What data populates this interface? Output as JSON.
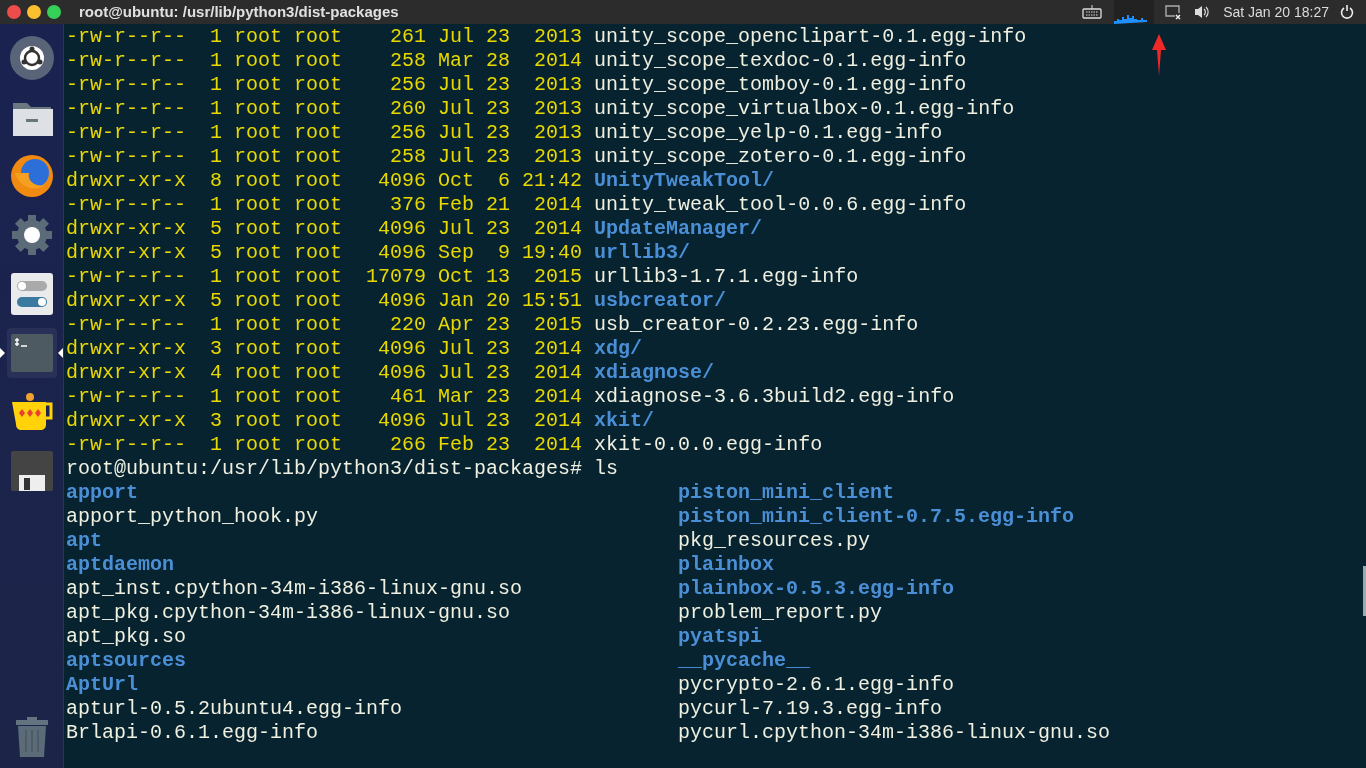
{
  "window": {
    "title": "root@ubuntu: /usr/lib/python3/dist-packages"
  },
  "panel": {
    "clock": "Sat Jan 20 18:27"
  },
  "launcher": [
    {
      "kind": "dash",
      "active": false
    },
    {
      "kind": "files",
      "active": false
    },
    {
      "kind": "browser",
      "active": false
    },
    {
      "kind": "settings",
      "active": false
    },
    {
      "kind": "tweak",
      "active": false
    },
    {
      "kind": "terminal",
      "active": true
    },
    {
      "kind": "teapot",
      "active": false
    },
    {
      "kind": "disk",
      "active": false
    },
    {
      "kind": "trash",
      "active": false
    }
  ],
  "listing": [
    {
      "info": "-rw-r--r--  1 root root    261 Jul 23  2013",
      "name": "unity_scope_openclipart-0.1.egg-info",
      "kind": "file"
    },
    {
      "info": "-rw-r--r--  1 root root    258 Mar 28  2014",
      "name": "unity_scope_texdoc-0.1.egg-info",
      "kind": "file"
    },
    {
      "info": "-rw-r--r--  1 root root    256 Jul 23  2013",
      "name": "unity_scope_tomboy-0.1.egg-info",
      "kind": "file"
    },
    {
      "info": "-rw-r--r--  1 root root    260 Jul 23  2013",
      "name": "unity_scope_virtualbox-0.1.egg-info",
      "kind": "file"
    },
    {
      "info": "-rw-r--r--  1 root root    256 Jul 23  2013",
      "name": "unity_scope_yelp-0.1.egg-info",
      "kind": "file"
    },
    {
      "info": "-rw-r--r--  1 root root    258 Jul 23  2013",
      "name": "unity_scope_zotero-0.1.egg-info",
      "kind": "file"
    },
    {
      "info": "drwxr-xr-x  8 root root   4096 Oct  6 21:42",
      "name": "UnityTweakTool/",
      "kind": "dir"
    },
    {
      "info": "-rw-r--r--  1 root root    376 Feb 21  2014",
      "name": "unity_tweak_tool-0.0.6.egg-info",
      "kind": "file"
    },
    {
      "info": "drwxr-xr-x  5 root root   4096 Jul 23  2014",
      "name": "UpdateManager/",
      "kind": "dir"
    },
    {
      "info": "drwxr-xr-x  5 root root   4096 Sep  9 19:40",
      "name": "urllib3/",
      "kind": "dir"
    },
    {
      "info": "-rw-r--r--  1 root root  17079 Oct 13  2015",
      "name": "urllib3-1.7.1.egg-info",
      "kind": "file"
    },
    {
      "info": "drwxr-xr-x  5 root root   4096 Jan 20 15:51",
      "name": "usbcreator/",
      "kind": "dir"
    },
    {
      "info": "-rw-r--r--  1 root root    220 Apr 23  2015",
      "name": "usb_creator-0.2.23.egg-info",
      "kind": "file"
    },
    {
      "info": "drwxr-xr-x  3 root root   4096 Jul 23  2014",
      "name": "xdg/",
      "kind": "dir"
    },
    {
      "info": "drwxr-xr-x  4 root root   4096 Jul 23  2014",
      "name": "xdiagnose/",
      "kind": "dir"
    },
    {
      "info": "-rw-r--r--  1 root root    461 Mar 23  2014",
      "name": "xdiagnose-3.6.3build2.egg-info",
      "kind": "file"
    },
    {
      "info": "drwxr-xr-x  3 root root   4096 Jul 23  2014",
      "name": "xkit/",
      "kind": "dir"
    },
    {
      "info": "-rw-r--r--  1 root root    266 Feb 23  2014",
      "name": "xkit-0.0.0.egg-info",
      "kind": "file"
    }
  ],
  "prompt": "root@ubuntu:/usr/lib/python3/dist-packages# ls",
  "ls_rows": [
    {
      "left": {
        "name": "apport",
        "kind": "dir"
      },
      "right": {
        "name": "piston_mini_client",
        "kind": "dir"
      }
    },
    {
      "left": {
        "name": "apport_python_hook.py",
        "kind": "file"
      },
      "right": {
        "name": "piston_mini_client-0.7.5.egg-info",
        "kind": "dir"
      }
    },
    {
      "left": {
        "name": "apt",
        "kind": "dir"
      },
      "right": {
        "name": "pkg_resources.py",
        "kind": "file"
      }
    },
    {
      "left": {
        "name": "aptdaemon",
        "kind": "dir"
      },
      "right": {
        "name": "plainbox",
        "kind": "dir"
      }
    },
    {
      "left": {
        "name": "apt_inst.cpython-34m-i386-linux-gnu.so",
        "kind": "file"
      },
      "right": {
        "name": "plainbox-0.5.3.egg-info",
        "kind": "dir"
      }
    },
    {
      "left": {
        "name": "apt_pkg.cpython-34m-i386-linux-gnu.so",
        "kind": "file"
      },
      "right": {
        "name": "problem_report.py",
        "kind": "file"
      }
    },
    {
      "left": {
        "name": "apt_pkg.so",
        "kind": "file"
      },
      "right": {
        "name": "pyatspi",
        "kind": "dir"
      }
    },
    {
      "left": {
        "name": "aptsources",
        "kind": "dir"
      },
      "right": {
        "name": "__pycache__",
        "kind": "dir"
      }
    },
    {
      "left": {
        "name": "AptUrl",
        "kind": "dir"
      },
      "right": {
        "name": "pycrypto-2.6.1.egg-info",
        "kind": "file"
      }
    },
    {
      "left": {
        "name": "apturl-0.5.2ubuntu4.egg-info",
        "kind": "file"
      },
      "right": {
        "name": "pycurl-7.19.3.egg-info",
        "kind": "file"
      }
    },
    {
      "left": {
        "name": "Brlapi-0.6.1.egg-info",
        "kind": "file"
      },
      "right": {
        "name": "pycurl.cpython-34m-i386-linux-gnu.so",
        "kind": "file"
      }
    }
  ]
}
